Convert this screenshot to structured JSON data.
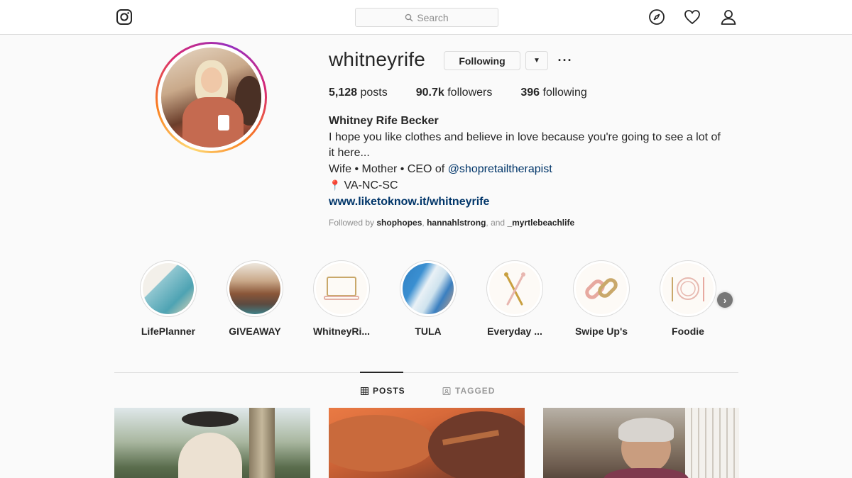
{
  "nav": {
    "search_placeholder": "Search",
    "icons": [
      "instagram-logo-icon",
      "search-icon",
      "compass-icon",
      "heart-icon",
      "user-icon"
    ]
  },
  "profile": {
    "username": "whitneyrife",
    "following_button": "Following",
    "dropdown_glyph": "▼",
    "more_glyph": "···",
    "stats": {
      "posts_count": "5,128",
      "posts_label": " posts",
      "followers_count": "90.7k",
      "followers_label": " followers",
      "following_count": "396",
      "following_label": " following"
    },
    "bio": {
      "full_name": "Whitney Rife Becker",
      "line1": "I hope you like clothes and believe in love because you're going to see a lot of it here...",
      "line2_prefix": "Wife • Mother • CEO of ",
      "line2_mention": "@shopretailtherapist",
      "location_pin": "📍",
      "location": "VA-NC-SC",
      "website": "www.liketoknow.it/whitneyrife"
    },
    "followed_by": {
      "prefix": "Followed by ",
      "user1": "shophopes",
      "sep1": ", ",
      "user2": "hannahlstrong",
      "sep2": ", and ",
      "user3": "_myrtlebeachlife"
    }
  },
  "highlights": [
    {
      "label": "LifePlanner"
    },
    {
      "label": "GIVEAWAY"
    },
    {
      "label": "WhitneyRi..."
    },
    {
      "label": "TULA"
    },
    {
      "label": "Everyday ..."
    },
    {
      "label": "Swipe Up's"
    },
    {
      "label": "Foodie"
    }
  ],
  "highlights_next_glyph": "›",
  "tabs": {
    "posts": "POSTS",
    "tagged": "TAGGED",
    "active": "posts"
  },
  "colors": {
    "link": "#003569",
    "border": "#dbdbdb",
    "text": "#262626",
    "muted": "#8e8e8e",
    "background": "#fafafa"
  }
}
